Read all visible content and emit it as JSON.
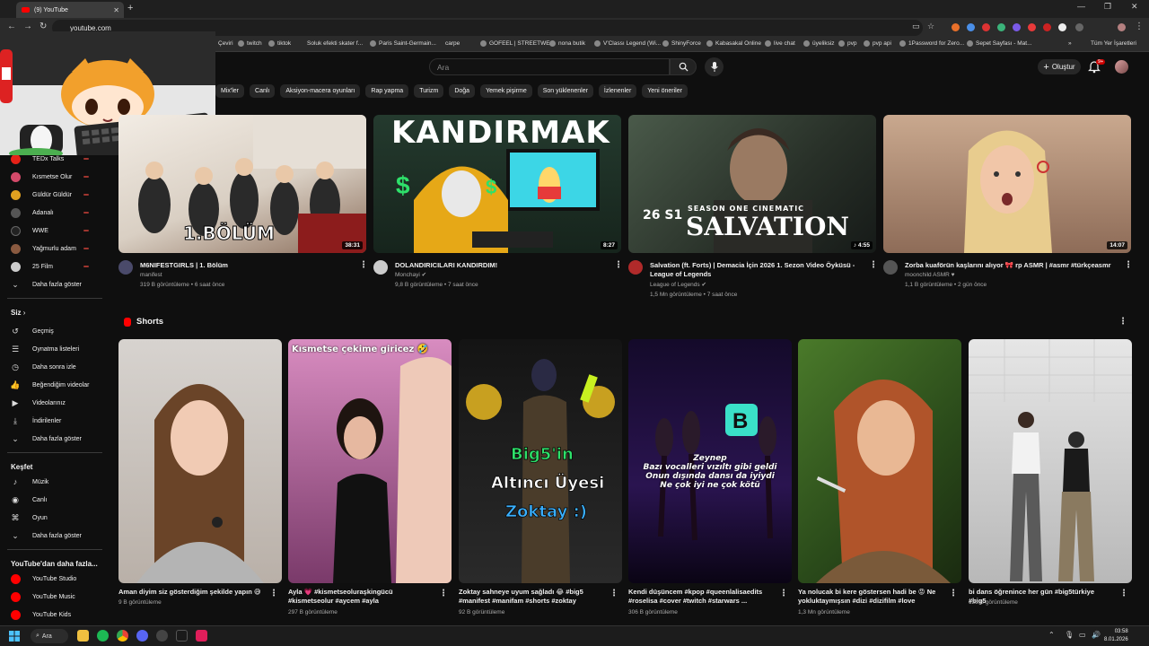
{
  "browser": {
    "tab_title": "(9) YouTube",
    "url": "youtube.com",
    "bookmarks": [
      "Çeviri",
      "twitch",
      "tiktok",
      "Soluk efekti skater f...",
      "Paris Saint-Germain...",
      "carpe",
      "GOFEEL | STREETWE...",
      "nona butik",
      "V'Classı Legend (Wi...",
      "ShinyForce",
      "Kabasakal Online",
      "live chat",
      "üyeliksiz",
      "pvp",
      "pvp api",
      "1Password for Zero...",
      "Sepet Sayfası - Mat..."
    ],
    "all_bookmarks": "Tüm Yer İşaretleri"
  },
  "header": {
    "search_placeholder": "Ara",
    "create_label": "Oluştur",
    "notification_count": "9+"
  },
  "chips": [
    "Mix'ler",
    "Canlı",
    "Aksiyon-macera oyunları",
    "Rap yapma",
    "Turizm",
    "Doğa",
    "Yemek pişirme",
    "Son yüklenenler",
    "İzlenenler",
    "Yeni öneriler"
  ],
  "sidebar": {
    "subscriptions": [
      {
        "label": "TEDx Talks",
        "color": "#e62117"
      },
      {
        "label": "Kısmetse Olur",
        "color": "#d44a6a"
      },
      {
        "label": "Güldür Güldür",
        "color": "#e0a020"
      },
      {
        "label": "Adanalı",
        "color": "#555555"
      },
      {
        "label": "WWE",
        "color": "#222222"
      },
      {
        "label": "Yağmurlu adam",
        "color": "#8a5a40"
      },
      {
        "label": "25 Film",
        "color": "#cccccc"
      }
    ],
    "show_more": "Daha fazla göster",
    "you_section": "Siz",
    "you_items": [
      "Geçmiş",
      "Oynatma listeleri",
      "Daha sonra izle",
      "Beğendiğim videolar",
      "Videolarınız",
      "İndirilenler",
      "Daha fazla göster"
    ],
    "explore_section": "Keşfet",
    "explore_items": [
      "Müzik",
      "Canlı",
      "Oyun",
      "Daha fazla göster"
    ],
    "more_section": "YouTube'dan daha fazla...",
    "more_items": [
      "YouTube Studio",
      "YouTube Music",
      "YouTube Kids"
    ]
  },
  "videos": [
    {
      "title": "M6NIFESTGIRLS | 1. Bölüm",
      "channel": "manifest",
      "meta": "319 B görüntüleme • 6 saat önce",
      "duration": "38:31",
      "overlay": "1.BÖLÜM"
    },
    {
      "title": "DOLANDIRICILARI KANDIRDIM!",
      "channel": "Monchayi",
      "meta": "9,8 B görüntüleme • 7 saat önce",
      "duration": "8:27",
      "overlay": "KANDIRMAK"
    },
    {
      "title": "Salvation (ft. Forts) | Demacia İçin 2026 1. Sezon Video Öyküsü - League of Legends",
      "channel": "League of Legends",
      "meta": "1,5 Mn görüntüleme • 7 saat önce",
      "duration": "4:55",
      "overlay": "SALVATION",
      "overlay_small": "SEASON ONE CINEMATIC",
      "overlay_tag": "26 S1"
    },
    {
      "title": "Zorba kuaförün kaşlarını alıyor 🎀 rp ASMR | #asmr #türkçeasmr",
      "channel": "moonchild ASMR",
      "meta": "1,1 B görüntüleme • 2 gün önce",
      "duration": "14:07"
    }
  ],
  "shorts": {
    "heading": "Shorts",
    "items": [
      {
        "title": "Aman diyim siz gösterdiğim şekilde yapın 😅",
        "meta": "9 B görüntüleme"
      },
      {
        "title": "Ayla 💗 #kismetseoluraşkingücü #kismetseolur #aycem #ayla",
        "meta": "297 B görüntüleme",
        "overlay": "Kısmetse çekime giricez 🤣"
      },
      {
        "title": "Zoktay sahneye uyum sağladı 😂 #big5 #manifest #manifam #shorts #zoktay",
        "meta": "92 B görüntüleme",
        "overlay1": "Big5'in",
        "overlay2": "Altıncı Üyesi",
        "overlay3": "Zoktay :)"
      },
      {
        "title": "Kendi düşüncem #kpop #queenlalisaedits #roselisa #cover #twitch #starwars ...",
        "meta": "306 B görüntüleme",
        "overlay": "Zeynep\nBazı vocalleri vızıltı gibi geldi\nOnun dışında dansı da iyiydi\nNe çok iyi ne çok kötü"
      },
      {
        "title": "Ya nolucak bi kere göstersen hadi be 😡 Ne yokluktaymışsın #dizi #dizifilm #love",
        "meta": "1,3 Mn görüntüleme"
      },
      {
        "title": "bi dans öğrenince her gün #big5türkiye #big5",
        "meta": "125 B görüntüleme"
      }
    ]
  },
  "taskbar": {
    "search_label": "Ara",
    "time": "03:58",
    "date": "8.01.2026"
  }
}
